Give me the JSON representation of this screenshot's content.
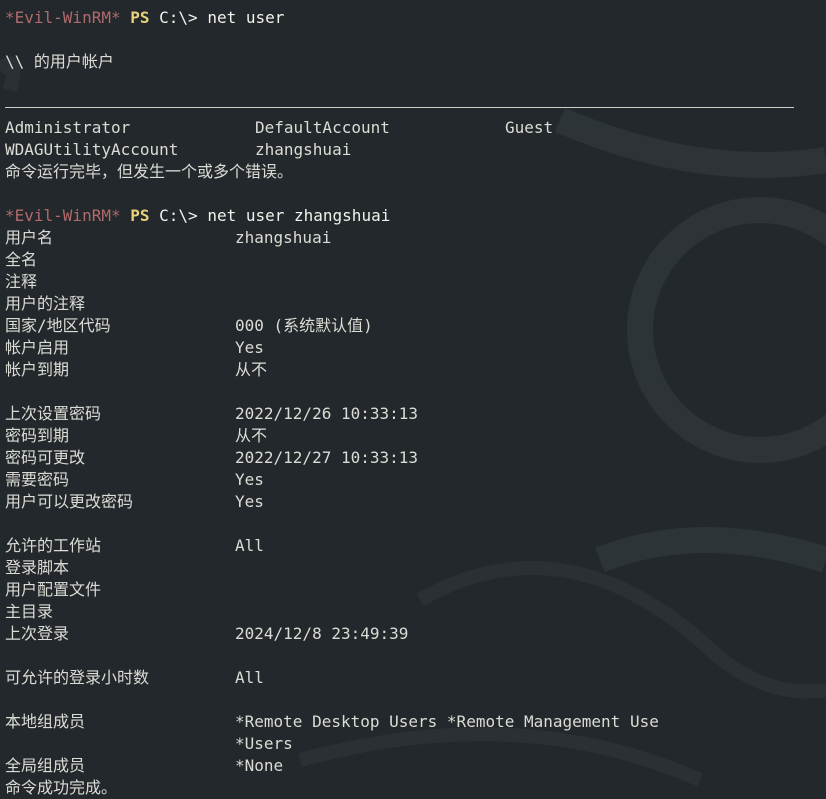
{
  "prompt": {
    "name": "*Evil-WinRM*",
    "ps": "PS",
    "path": "C:\\>"
  },
  "commands": {
    "first": "net user",
    "second": "net user zhangshuai"
  },
  "net_user_output": {
    "header": "\\\\ 的用户帐户",
    "accounts_row1": [
      "Administrator",
      "DefaultAccount",
      "Guest"
    ],
    "accounts_row2": [
      "WDAGUtilityAccount",
      "zhangshuai"
    ],
    "status": "命令运行完毕，但发生一个或多个错误。"
  },
  "user_details": {
    "rows": [
      {
        "label": "用户名",
        "value": "zhangshuai"
      },
      {
        "label": "全名",
        "value": ""
      },
      {
        "label": "注释",
        "value": ""
      },
      {
        "label": "用户的注释",
        "value": ""
      },
      {
        "label": "国家/地区代码",
        "value": "000 (系统默认值)"
      },
      {
        "label": "帐户启用",
        "value": "Yes"
      },
      {
        "label": "帐户到期",
        "value": "从不"
      },
      {
        "label": "上次设置密码",
        "value": "2022/12/26 10:33:13"
      },
      {
        "label": "密码到期",
        "value": "从不"
      },
      {
        "label": "密码可更改",
        "value": "2022/12/27 10:33:13"
      },
      {
        "label": "需要密码",
        "value": "Yes"
      },
      {
        "label": "用户可以更改密码",
        "value": "Yes"
      },
      {
        "label": "允许的工作站",
        "value": "All"
      },
      {
        "label": "登录脚本",
        "value": ""
      },
      {
        "label": "用户配置文件",
        "value": ""
      },
      {
        "label": "主目录",
        "value": ""
      },
      {
        "label": "上次登录",
        "value": "2024/12/8 23:49:39"
      },
      {
        "label": "可允许的登录小时数",
        "value": "All"
      },
      {
        "label": "本地组成员",
        "value": "*Remote Desktop Users *Remote Management Use"
      },
      {
        "label": "",
        "value": "*Users"
      },
      {
        "label": "全局组成员",
        "value": "*None"
      }
    ],
    "status": "命令成功完成。"
  },
  "colors": {
    "background": "#23282c",
    "text": "#dcdcd6",
    "prompt_name": "#b06a6c",
    "prompt_ps": "#e8d27a"
  }
}
